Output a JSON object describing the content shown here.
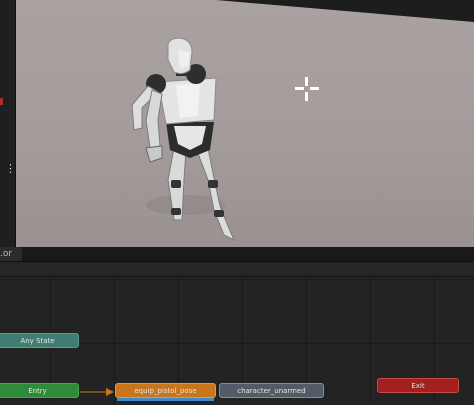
{
  "animator": {
    "tab_label": ".or",
    "states": {
      "any_state": "Any State",
      "entry": "Entry",
      "equip_pistol_pose": "equip_pistol_pose",
      "character_unarmed": "character_unarmed",
      "exit": "Exit"
    }
  },
  "scene": {
    "sidebar_menu_glyph": "⋮"
  },
  "colors": {
    "any_state": "#3f7d72",
    "entry": "#2f8a3a",
    "default_state": "#c8751c",
    "state": "#525b66",
    "exit": "#a3201e",
    "progress": "#3a8bd0"
  },
  "icons": [
    "crosshair-icon",
    "more-icon"
  ]
}
